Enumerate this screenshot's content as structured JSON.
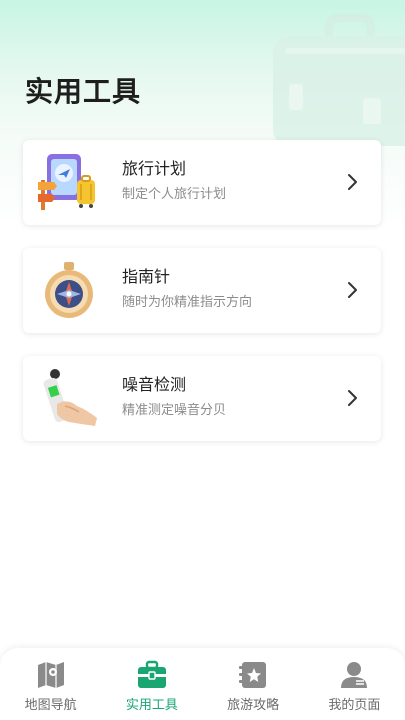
{
  "page": {
    "title": "实用工具"
  },
  "tools": [
    {
      "title": "旅行计划",
      "desc": "制定个人旅行计划",
      "icon": "travel-plan-icon"
    },
    {
      "title": "指南针",
      "desc": "随时为你精准指示方向",
      "icon": "compass-icon"
    },
    {
      "title": "噪音检测",
      "desc": "精准测定噪音分贝",
      "icon": "sound-meter-icon"
    }
  ],
  "tabs": [
    {
      "label": "地图导航",
      "icon": "map-icon",
      "active": false
    },
    {
      "label": "实用工具",
      "icon": "toolbox-icon",
      "active": true
    },
    {
      "label": "旅游攻略",
      "icon": "guidebook-icon",
      "active": false
    },
    {
      "label": "我的页面",
      "icon": "user-icon",
      "active": false
    }
  ],
  "colors": {
    "accent": "#1aa672",
    "inactive": "#6b6b6b",
    "header_mint": "#c7f5e4"
  }
}
